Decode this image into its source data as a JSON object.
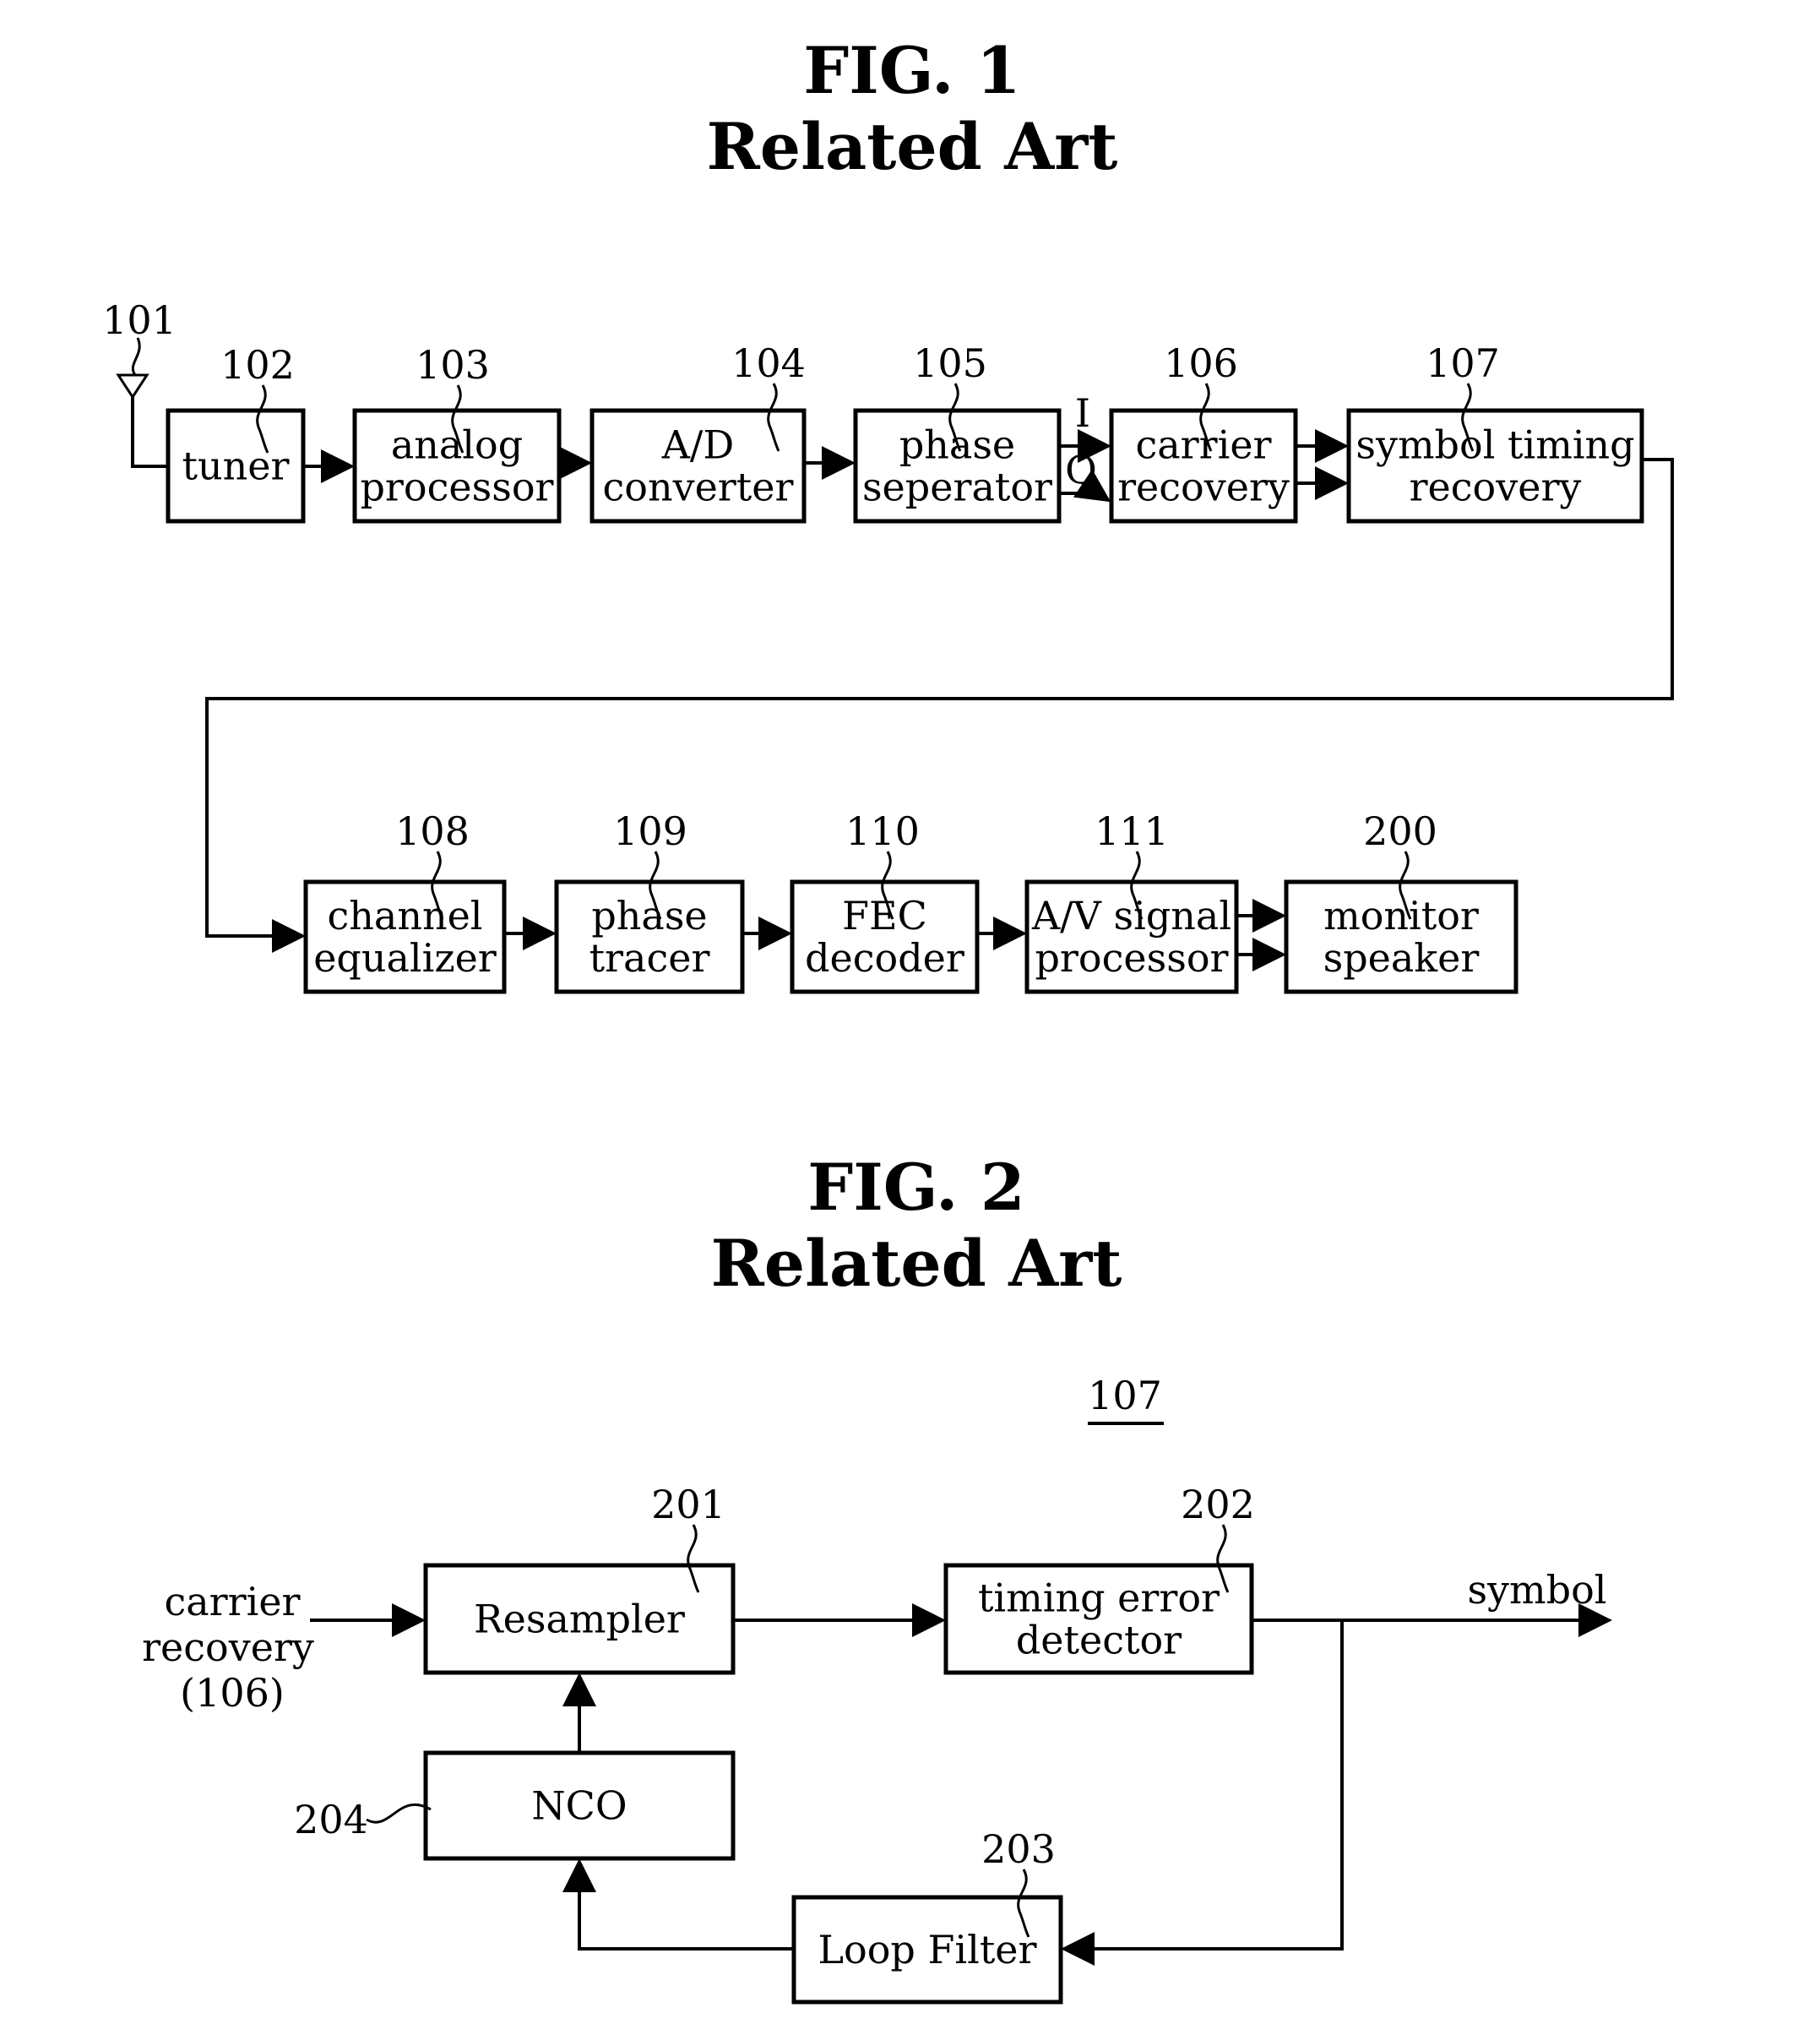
{
  "fig1": {
    "title": "FIG. 1",
    "subtitle": "Related Art",
    "antenna_ref": "101",
    "blocks": [
      {
        "ref": "102",
        "lines": [
          "tuner"
        ]
      },
      {
        "ref": "103",
        "lines": [
          "analog",
          "processor"
        ]
      },
      {
        "ref": "104",
        "lines": [
          "A/D",
          "converter"
        ]
      },
      {
        "ref": "105",
        "lines": [
          "phase",
          "seperator"
        ]
      },
      {
        "ref": "106",
        "lines": [
          "carrier",
          "recovery"
        ]
      },
      {
        "ref": "107",
        "lines": [
          "symbol timing",
          "recovery"
        ]
      },
      {
        "ref": "108",
        "lines": [
          "channel",
          "equalizer"
        ]
      },
      {
        "ref": "109",
        "lines": [
          "phase",
          "tracer"
        ]
      },
      {
        "ref": "110",
        "lines": [
          "FEC",
          "decoder"
        ]
      },
      {
        "ref": "111",
        "lines": [
          "A/V signal",
          "processor"
        ]
      },
      {
        "ref": "200",
        "lines": [
          "monitor",
          "speaker"
        ]
      }
    ],
    "signal_labels": {
      "i": "I",
      "q": "Q"
    }
  },
  "fig2": {
    "title": "FIG. 2",
    "subtitle": "Related Art",
    "assembly_ref": "107",
    "input_label": [
      "carrier",
      "recovery",
      "(106)"
    ],
    "output_label": "symbol",
    "blocks": [
      {
        "ref": "201",
        "lines": [
          "Resampler"
        ]
      },
      {
        "ref": "202",
        "lines": [
          "timing error",
          "detector"
        ]
      },
      {
        "ref": "203",
        "lines": [
          "Loop Filter"
        ]
      },
      {
        "ref": "204",
        "lines": [
          "NCO"
        ]
      }
    ]
  }
}
